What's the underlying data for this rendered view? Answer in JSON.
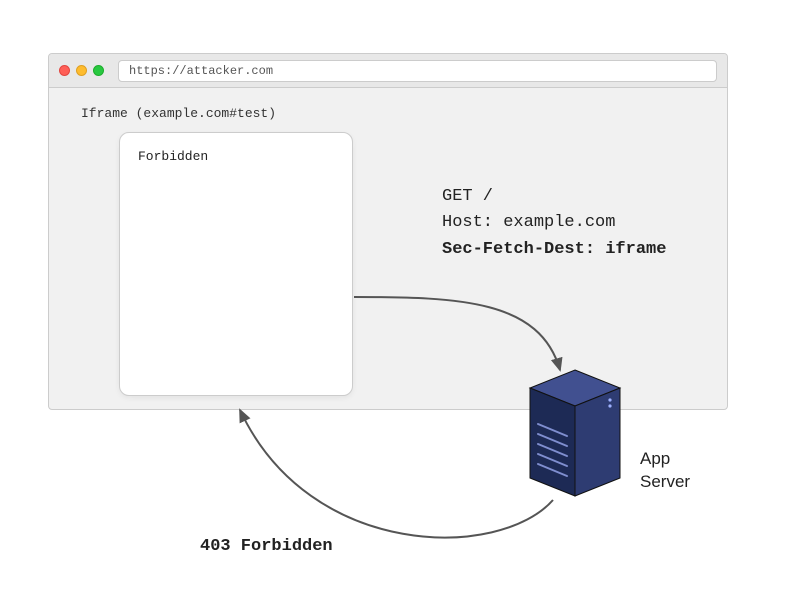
{
  "browser": {
    "url": "https://attacker.com"
  },
  "iframe": {
    "label": "Iframe (example.com#test)",
    "content": "Forbidden"
  },
  "request": {
    "line1": "GET /",
    "line2": "Host: example.com",
    "line3": "Sec-Fetch-Dest: iframe"
  },
  "server": {
    "label": "App\nServer"
  },
  "response": {
    "status": "403 Forbidden"
  },
  "colors": {
    "arrow": "#555555",
    "server_dark": "#1d2a55",
    "server_mid": "#2e3c72",
    "server_light": "#415090"
  }
}
